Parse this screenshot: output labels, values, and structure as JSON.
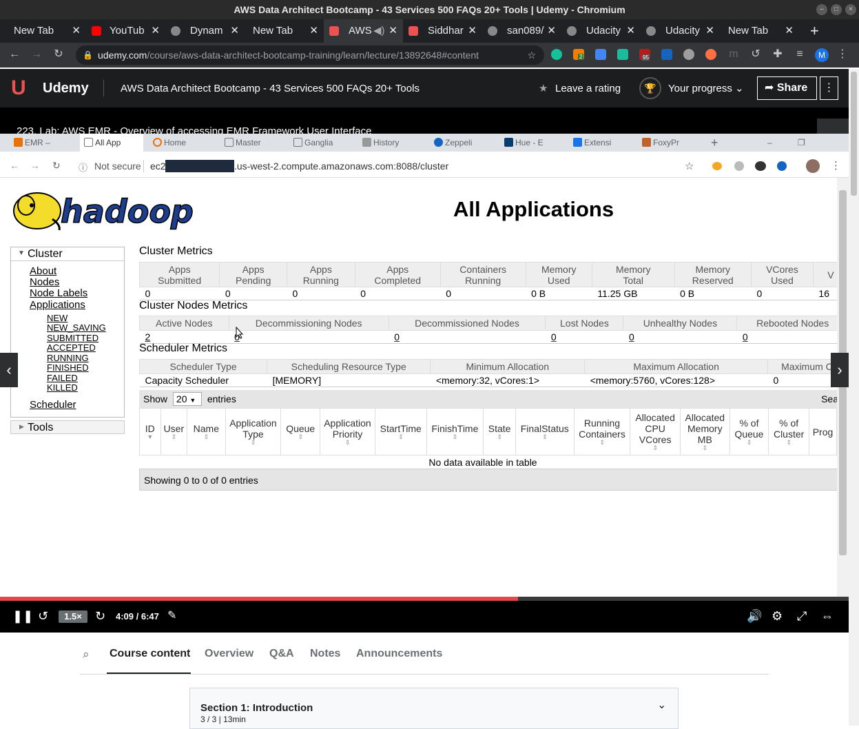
{
  "window": {
    "title": "AWS Data Architect Bootcamp - 43 Services 500 FAQs 20+ Tools | Udemy - Chromium"
  },
  "tabs": [
    {
      "label": "New Tab"
    },
    {
      "label": "YouTub"
    },
    {
      "label": "Dynam"
    },
    {
      "label": "New Tab"
    },
    {
      "label": "AWS"
    },
    {
      "label": "Siddhar"
    },
    {
      "label": "san089/"
    },
    {
      "label": "Udacity"
    },
    {
      "label": "Udacity"
    },
    {
      "label": "New Tab"
    }
  ],
  "address": {
    "host": "udemy.com",
    "path": "/course/aws-data-architect-bootcamp-training/learn/lecture/13892648#content"
  },
  "extensions": {
    "badge_orange": "2",
    "badge_red": "95",
    "profile": "M"
  },
  "udemy": {
    "logo": "Udemy",
    "course_title": "AWS Data Architect Bootcamp - 43 Services 500 FAQs 20+ Tools",
    "rating": "Leave a rating",
    "progress": "Your progress",
    "share": "Share"
  },
  "lecture": {
    "title": "223. Lab: AWS EMR - Overview of accessing EMR Framework User Interface"
  },
  "inner_tabs": [
    {
      "label": "EMR –"
    },
    {
      "label": "All App"
    },
    {
      "label": "Home"
    },
    {
      "label": "Master"
    },
    {
      "label": "Ganglia"
    },
    {
      "label": "History"
    },
    {
      "label": "Zeppeli"
    },
    {
      "label": "Hue - E"
    },
    {
      "label": "Extensi"
    },
    {
      "label": "FoxyPr"
    }
  ],
  "inner_address": {
    "security": "Not secure",
    "prefix": "ec2-",
    "suffix": ".us-west-2.compute.amazonaws.com:8088/cluster"
  },
  "hadoop": {
    "logo_text": "hadoop",
    "heading": "All Applications",
    "nav": {
      "cluster": "Cluster",
      "about": "About",
      "nodes": "Nodes",
      "node_labels": "Node Labels",
      "applications": "Applications",
      "states": [
        "NEW",
        "NEW_SAVING",
        "SUBMITTED",
        "ACCEPTED",
        "RUNNING",
        "FINISHED",
        "FAILED",
        "KILLED"
      ],
      "scheduler": "Scheduler",
      "tools": "Tools"
    },
    "cluster_metrics": {
      "title": "Cluster Metrics",
      "headers": [
        [
          "Apps",
          "Submitted"
        ],
        [
          "Apps",
          "Pending"
        ],
        [
          "Apps",
          "Running"
        ],
        [
          "Apps",
          "Completed"
        ],
        [
          "Containers",
          "Running"
        ],
        [
          "Memory",
          "Used"
        ],
        [
          "Memory",
          "Total"
        ],
        [
          "Memory",
          "Reserved"
        ],
        [
          "VCores",
          "Used"
        ],
        [
          "V",
          ""
        ]
      ],
      "values": [
        "0",
        "0",
        "0",
        "0",
        "0",
        "0 B",
        "11.25 GB",
        "0 B",
        "0",
        "16"
      ]
    },
    "node_metrics": {
      "title": "Cluster Nodes Metrics",
      "headers": [
        "Active Nodes",
        "Decommissioning Nodes",
        "Decommissioned Nodes",
        "Lost Nodes",
        "Unhealthy Nodes",
        "Rebooted Nodes"
      ],
      "values": [
        "2",
        "0",
        "0",
        "0",
        "0",
        "0"
      ]
    },
    "scheduler_metrics": {
      "title": "Scheduler Metrics",
      "headers": [
        "Scheduler Type",
        "Scheduling Resource Type",
        "Minimum Allocation",
        "Maximum Allocation",
        "Maximum Cl"
      ],
      "values": [
        "Capacity Scheduler",
        "[MEMORY]",
        "<memory:32, vCores:1>",
        "<memory:5760, vCores:128>",
        "0"
      ]
    },
    "apps": {
      "show": "Show",
      "entries_value": "20",
      "entries": "entries",
      "search": "Sea",
      "headers": [
        "ID",
        "User",
        "Name",
        "Application Type",
        "Queue",
        "Application Priority",
        "StartTime",
        "FinishTime",
        "State",
        "FinalStatus",
        "Running Containers",
        "Allocated CPU VCores",
        "Allocated Memory MB",
        "% of Queue",
        "% of Cluster",
        "Prog"
      ],
      "empty": "No data available in table",
      "showing": "Showing 0 to 0 of 0 entries"
    }
  },
  "player": {
    "time": "4:09 / 6:47",
    "speed": "1.5×",
    "progress_fraction": 0.61
  },
  "course_tabs": [
    "Course content",
    "Overview",
    "Q&A",
    "Notes",
    "Announcements"
  ],
  "section": {
    "title": "Section 1: Introduction",
    "meta": "3 / 3 | 13min"
  }
}
